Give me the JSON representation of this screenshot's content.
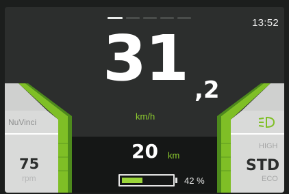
{
  "header": {
    "time": "13:52",
    "pages": {
      "count": 5,
      "active": 0
    }
  },
  "speed": {
    "integer": "31",
    "decimal": ",2",
    "unit": "km/h"
  },
  "left_panel": {
    "brand": "NuVinci",
    "cadence_value": "75",
    "cadence_unit": "rpm"
  },
  "right_panel": {
    "headlight_icon": "headlight-icon",
    "mode_above": "HIGH",
    "mode_current": "STD",
    "mode_below": "ECO"
  },
  "range": {
    "value": "20",
    "unit": "km"
  },
  "battery": {
    "level": 0.42,
    "percent_text": "42 %"
  },
  "colors": {
    "accent_green": "#8fcf2f",
    "battery_green": "#9bd53a",
    "background": "#2c2e2d"
  }
}
